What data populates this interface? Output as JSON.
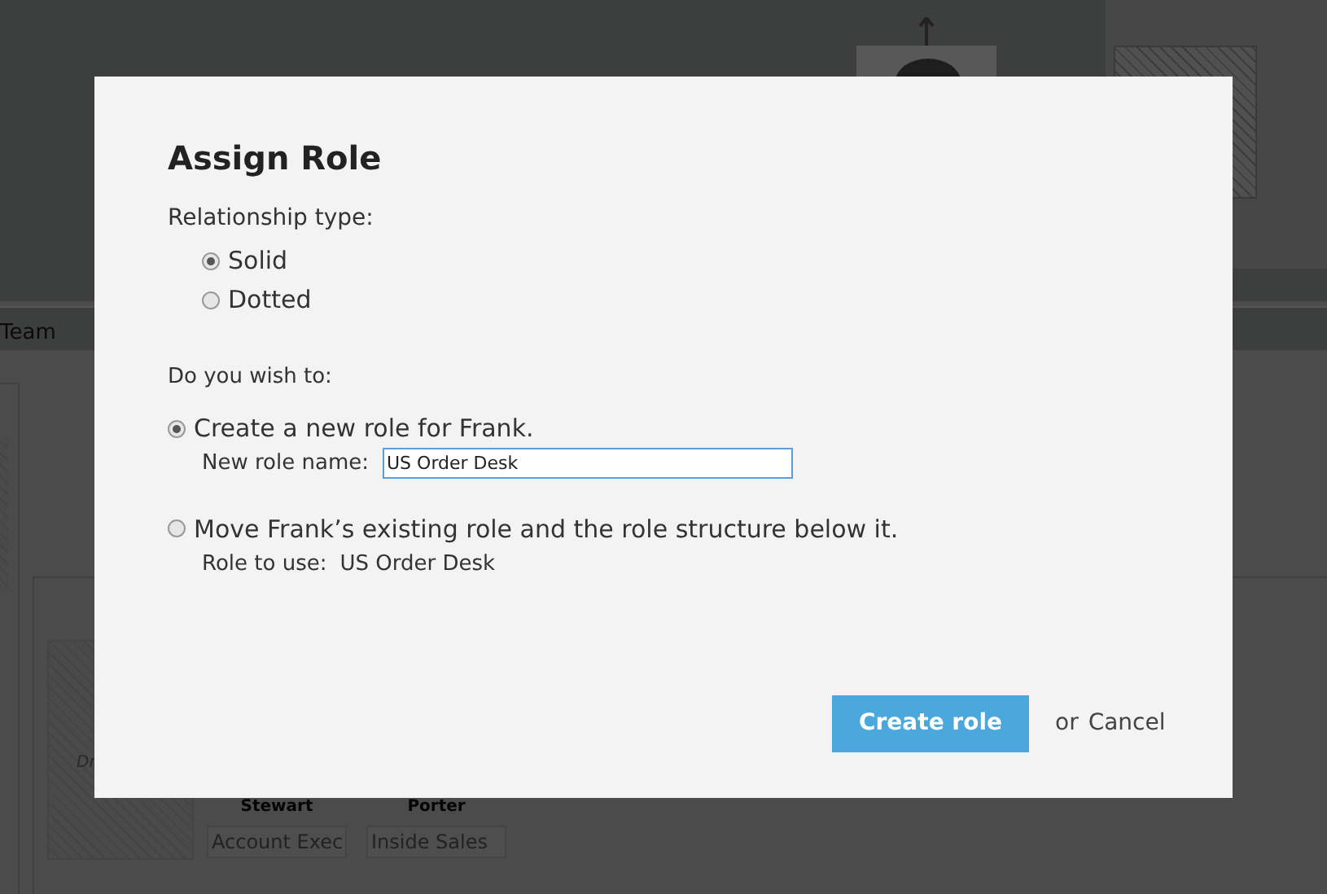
{
  "background": {
    "tab_label": "Team",
    "drop_hint": "Dr",
    "chart_cards": [
      {
        "name": "Stewart",
        "role": "Account Exec"
      },
      {
        "name": "Porter",
        "role": "Inside Sales"
      }
    ]
  },
  "dialog": {
    "title": "Assign Role",
    "relationship_label": "Relationship type:",
    "relationship_options": [
      {
        "label": "Solid",
        "selected": true
      },
      {
        "label": "Dotted",
        "selected": false
      }
    ],
    "action_label": "Do you wish to:",
    "actions": [
      {
        "kind": "input",
        "label": "Create a new role for Frank.",
        "selected": true,
        "field_label": "New role name:",
        "field_value": "US Order Desk"
      },
      {
        "kind": "text",
        "label": "Move Frank’s existing role and the role structure below it.",
        "selected": false,
        "field_label": "Role to use:",
        "field_value": "US Order Desk"
      }
    ],
    "primary_button": "Create role",
    "separator": "or",
    "cancel_link": "Cancel"
  }
}
